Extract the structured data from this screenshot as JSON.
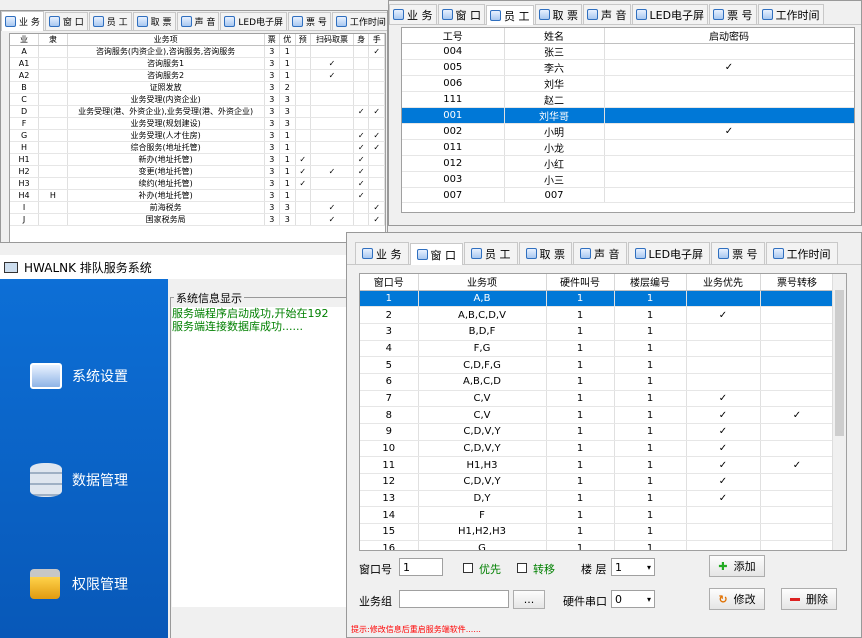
{
  "tab_labels": [
    "业 务",
    "窗 口",
    "员 工",
    "取 票",
    "声 音",
    "LED电子屏",
    "票 号",
    "工作时间"
  ],
  "business_table": {
    "headers": [
      "业",
      "隶",
      "业务项",
      "票",
      "优",
      "预",
      "扫码取票",
      "身",
      "手"
    ],
    "rows": [
      [
        "A",
        "",
        "咨询服务(内资企业),咨询服务,咨询服务",
        "3",
        "1",
        "",
        "",
        "",
        "✓"
      ],
      [
        "A1",
        "",
        "咨询服务1",
        "3",
        "1",
        "",
        "✓",
        "",
        ""
      ],
      [
        "A2",
        "",
        "咨询服务2",
        "3",
        "1",
        "",
        "✓",
        "",
        ""
      ],
      [
        "B",
        "",
        "证照发放",
        "3",
        "2",
        "",
        "",
        "",
        ""
      ],
      [
        "C",
        "",
        "业务受理(内资企业)",
        "3",
        "3",
        "",
        "",
        "",
        ""
      ],
      [
        "D",
        "",
        "业务受理(港、外资企业),业务受理(港、外资企业)",
        "3",
        "3",
        "",
        "",
        "✓",
        "✓"
      ],
      [
        "F",
        "",
        "业务受理(规划建设)",
        "3",
        "3",
        "",
        "",
        "",
        ""
      ],
      [
        "G",
        "",
        "业务受理(人才住房)",
        "3",
        "1",
        "",
        "",
        "✓",
        "✓"
      ],
      [
        "H",
        "",
        "综合服务(地址托管)",
        "3",
        "1",
        "",
        "",
        "✓",
        "✓"
      ],
      [
        "H1",
        "",
        "新办(地址托管)",
        "3",
        "1",
        "✓",
        "",
        "✓",
        ""
      ],
      [
        "H2",
        "",
        "变更(地址托管)",
        "3",
        "1",
        "✓",
        "✓",
        "✓",
        ""
      ],
      [
        "H3",
        "",
        "续约(地址托管)",
        "3",
        "1",
        "✓",
        "",
        "✓",
        ""
      ],
      [
        "H4",
        "H",
        "补办(地址托管)",
        "3",
        "1",
        "",
        "",
        "✓",
        ""
      ],
      [
        "I",
        "",
        "前海税务",
        "3",
        "3",
        "",
        "✓",
        "",
        "✓"
      ],
      [
        "J",
        "",
        "国家税务局",
        "3",
        "3",
        "",
        "✓",
        "",
        "✓"
      ]
    ]
  },
  "staff_table": {
    "headers": [
      "工号",
      "姓名",
      "启动密码"
    ],
    "rows": [
      [
        "004",
        "张三",
        ""
      ],
      [
        "005",
        "李六",
        "✓"
      ],
      [
        "006",
        "刘华",
        ""
      ],
      [
        "111",
        "赵二",
        ""
      ],
      [
        "001",
        "刘华哥",
        ""
      ],
      [
        "002",
        "小明",
        "✓"
      ],
      [
        "011",
        "小龙",
        ""
      ],
      [
        "012",
        "小红",
        ""
      ],
      [
        "003",
        "小三",
        ""
      ],
      [
        "007",
        "007",
        ""
      ]
    ],
    "selected_index": 4
  },
  "window_table": {
    "headers": [
      "窗口号",
      "业务项",
      "硬件叫号",
      "楼层编号",
      "业务优先",
      "票号转移"
    ],
    "rows": [
      [
        "1",
        "A,B",
        "1",
        "1",
        "",
        ""
      ],
      [
        "2",
        "A,B,C,D,V",
        "1",
        "1",
        "✓",
        ""
      ],
      [
        "3",
        "B,D,F",
        "1",
        "1",
        "",
        ""
      ],
      [
        "4",
        "F,G",
        "1",
        "1",
        "",
        ""
      ],
      [
        "5",
        "C,D,F,G",
        "1",
        "1",
        "",
        ""
      ],
      [
        "6",
        "A,B,C,D",
        "1",
        "1",
        "",
        ""
      ],
      [
        "7",
        "C,V",
        "1",
        "1",
        "✓",
        ""
      ],
      [
        "8",
        "C,V",
        "1",
        "1",
        "✓",
        "✓"
      ],
      [
        "9",
        "C,D,V,Y",
        "1",
        "1",
        "✓",
        ""
      ],
      [
        "10",
        "C,D,V,Y",
        "1",
        "1",
        "✓",
        ""
      ],
      [
        "11",
        "H1,H3",
        "1",
        "1",
        "✓",
        "✓"
      ],
      [
        "12",
        "C,D,V,Y",
        "1",
        "1",
        "✓",
        ""
      ],
      [
        "13",
        "D,Y",
        "1",
        "1",
        "✓",
        ""
      ],
      [
        "14",
        "F",
        "1",
        "1",
        "",
        ""
      ],
      [
        "15",
        "H1,H2,H3",
        "1",
        "1",
        "",
        ""
      ],
      [
        "16",
        "G",
        "1",
        "1",
        "",
        ""
      ]
    ],
    "selected_index": 0
  },
  "main_window": {
    "title": "HWALNK 排队服务系统",
    "nav": [
      "系统设置",
      "数据管理",
      "权限管理"
    ],
    "log_title": "系统信息显示",
    "log_lines": [
      "服务端程序启动成功,开始在192",
      "服务端连接数据库成功......"
    ]
  },
  "window_form": {
    "window_no_label": "窗口号",
    "window_no_value": "1",
    "priority_label": "优先",
    "transfer_label": "转移",
    "floor_label": "楼 层",
    "floor_value": "1",
    "add_label": "添加",
    "group_label": "业务组",
    "group_value": "",
    "browse_label": "...",
    "serial_label": "硬件串口",
    "serial_value": "0",
    "edit_label": "修改",
    "delete_label": "删除",
    "hint": "提示:修改信息后重启服务端软件......"
  },
  "colors": {
    "selection": "#0078d7",
    "nav_bg": "#0a63c8",
    "log_text": "#008000",
    "hint_text": "#ff0000"
  }
}
